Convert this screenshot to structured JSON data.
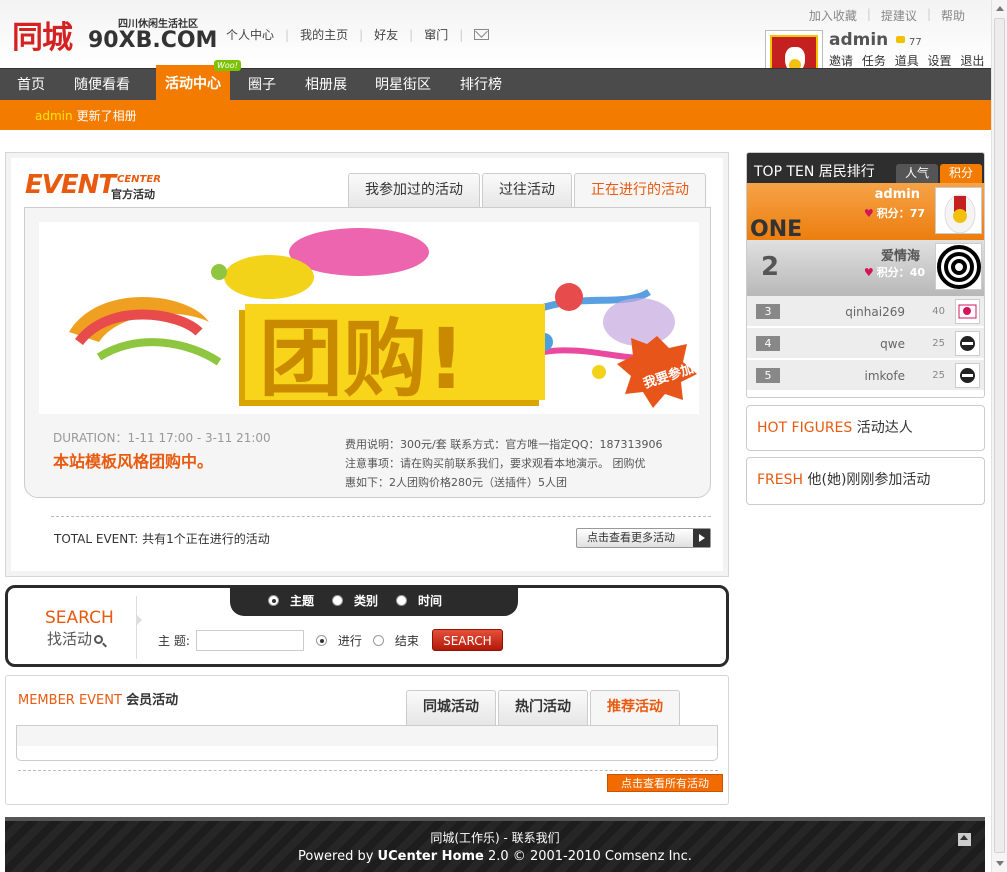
{
  "logo": {
    "brand": "同城",
    "tagline": "四川休闲生活社区",
    "domain": "90XB.COM"
  },
  "top_links": [
    "个人中心",
    "我的主页",
    "好友",
    "窜门"
  ],
  "corner_links": [
    "加入收藏",
    "提建议",
    "帮助"
  ],
  "user": {
    "name": "admin",
    "credits": "77",
    "links": [
      "邀请",
      "任务",
      "道具",
      "设置",
      "退出"
    ]
  },
  "nav": {
    "items": [
      "首页",
      "随便看看",
      "活动中心",
      "圈子",
      "相册展",
      "明星街区",
      "排行榜"
    ],
    "badge": "Woo!"
  },
  "subbar": {
    "user": "admin",
    "text": "更新了相册"
  },
  "event": {
    "title": "EVENT",
    "title_center": "CENTER",
    "title_sub": "官方活动",
    "tabs": [
      "我参加过的活动",
      "过往活动",
      "正在进行的活动"
    ],
    "banner_text": "团购!",
    "join_label": "我要参加",
    "duration": "DURATION：1-11 17:00 - 3-11 21:00",
    "name": "本站模板风格团购中。",
    "desc_lines": [
      "费用说明：300元/套  联系方式：官方唯一指定QQ：187313906",
      "注意事项：请在购买前联系我们，要求观看本地演示。    团购优",
      "惠如下：2人团购价格280元（送插件）5人团"
    ],
    "total_label": "TOTAL EVENT:",
    "total_text": "共有1个正在进行的活动",
    "more_btn": "点击查看更多活动"
  },
  "search": {
    "title": "SEARCH",
    "subtitle": "找活动",
    "scopes": [
      "主题",
      "类别",
      "时间"
    ],
    "field_label": "主 题:",
    "input_value": "",
    "status_options": [
      "进行",
      "结束"
    ],
    "button": "SEARCH"
  },
  "member": {
    "title_en": "MEMBER EVENT",
    "title_cn": "会员活动",
    "tabs": [
      "同城活动",
      "热门活动",
      "推荐活动"
    ],
    "all_btn": "点击查看所有活动"
  },
  "ranking": {
    "title": "TOP TEN 居民排行",
    "tabs": [
      "人气",
      "积分"
    ],
    "one_label": "ONE",
    "score_label": "积分：",
    "rows": [
      {
        "rank": "1",
        "name": "admin",
        "score": "77"
      },
      {
        "rank": "2",
        "name": "爱情海",
        "score": "40"
      },
      {
        "rank": "3",
        "name": "qinhai269",
        "score": "40"
      },
      {
        "rank": "4",
        "name": "qwe",
        "score": "25"
      },
      {
        "rank": "5",
        "name": "imkofe",
        "score": "25"
      }
    ]
  },
  "hot_figures": {
    "en": "HOT FIGURES",
    "cn": "活动达人"
  },
  "fresh": {
    "en": "FRESH",
    "cn": "他(她)刚刚参加活动"
  },
  "footer": {
    "line1": "同城(工作乐) - 联系我们",
    "line2_pre": "Powered by",
    "line2_brand": "UCenter Home",
    "line2_post": "2.0 © 2001-2010 Comsenz Inc."
  },
  "colors": {
    "accent": "#f27b00",
    "nav": "#4b4b4b",
    "title_orange": "#e85a0f"
  }
}
